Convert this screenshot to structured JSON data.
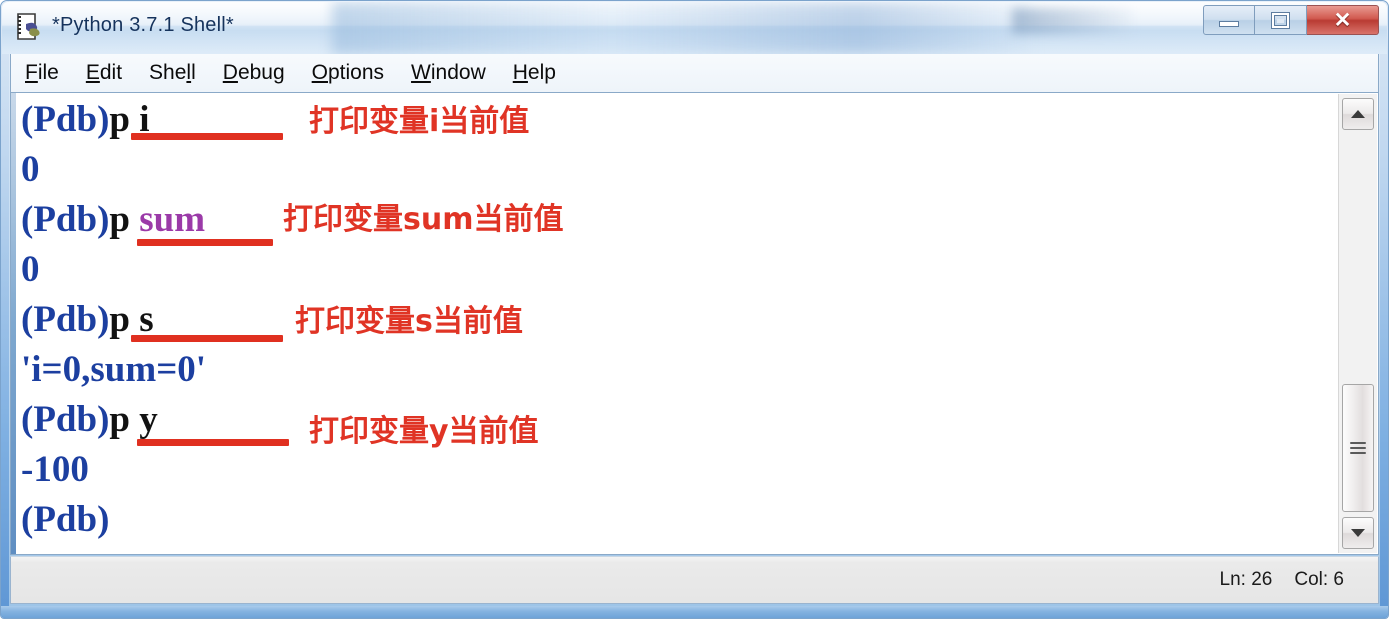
{
  "window": {
    "title": "*Python 3.7.1 Shell*",
    "icon": "python-file-icon",
    "controls": {
      "minimize": "–",
      "maximize": "□",
      "close": "✕"
    }
  },
  "menubar": {
    "items": [
      {
        "label": "File",
        "accel": "F"
      },
      {
        "label": "Edit",
        "accel": "E"
      },
      {
        "label": "Shell",
        "accel": "l"
      },
      {
        "label": "Debug",
        "accel": "D"
      },
      {
        "label": "Options",
        "accel": "O"
      },
      {
        "label": "Window",
        "accel": "W"
      },
      {
        "label": "Help",
        "accel": "H"
      }
    ]
  },
  "shell": {
    "lines": [
      {
        "prompt": "(Pdb)",
        "command": "p i",
        "output": null
      },
      {
        "prompt": null,
        "command": null,
        "output": "0"
      },
      {
        "prompt": "(Pdb)",
        "command": "p sum",
        "output": null
      },
      {
        "prompt": null,
        "command": null,
        "output": "0"
      },
      {
        "prompt": "(Pdb)",
        "command": "p s",
        "output": null
      },
      {
        "prompt": null,
        "command": null,
        "output": "'i=0,sum=0'"
      },
      {
        "prompt": "(Pdb)",
        "command": "p y",
        "output": null
      },
      {
        "prompt": null,
        "command": null,
        "output": "-100"
      },
      {
        "prompt": "(Pdb)",
        "command": "",
        "output": null
      }
    ],
    "commands": {
      "cmd1_verb": "p ",
      "cmd1_var": "i",
      "cmd2_verb": "p ",
      "cmd2_var": "sum",
      "cmd3_verb": "p ",
      "cmd3_var": "s",
      "cmd4_verb": "p ",
      "cmd4_var": "y"
    },
    "prompt_text": "(Pdb)",
    "outputs": {
      "o1": "0",
      "o2": "0",
      "o3": "'i=0,sum=0'",
      "o4": "-100"
    },
    "annotations": [
      "打印变量i当前值",
      "打印变量sum当前值",
      "打印变量s当前值",
      "打印变量y当前值"
    ]
  },
  "scrollbar": {
    "up_arrow": "scroll-up",
    "down_arrow": "scroll-down",
    "thumb": "scroll-thumb"
  },
  "statusbar": {
    "line_label": "Ln: 26",
    "col_label": "Col: 6"
  },
  "colors": {
    "prompt_blue": "#1c3fa0",
    "command_black": "#121212",
    "variable_purple": "#9b3aa8",
    "annotation_red": "#e03425",
    "underline_red": "#e03020",
    "close_button_red": "#c2443a"
  }
}
